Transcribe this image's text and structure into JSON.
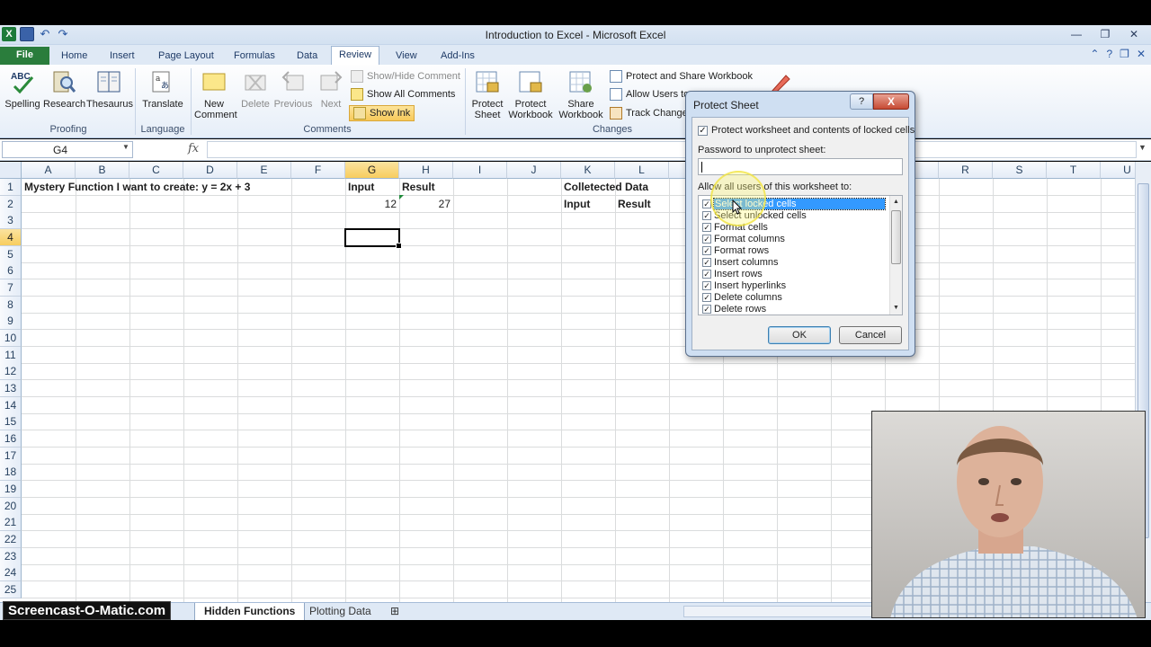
{
  "window": {
    "title": "Introduction to Excel  -  Microsoft Excel"
  },
  "ribbon_tabs": [
    "File",
    "Home",
    "Insert",
    "Page Layout",
    "Formulas",
    "Data",
    "Review",
    "View",
    "Add-Ins"
  ],
  "active_tab": "Review",
  "ribbon": {
    "proofing": {
      "label": "Proofing",
      "spelling": "Spelling",
      "research": "Research",
      "thesaurus": "Thesaurus",
      "abc_icon_text": "ABC"
    },
    "language": {
      "label": "Language",
      "translate": "Translate"
    },
    "comments": {
      "label": "Comments",
      "new_comment_1": "New",
      "new_comment_2": "Comment",
      "delete": "Delete",
      "previous": "Previous",
      "next": "Next",
      "show_hide": "Show/Hide Comment",
      "show_all": "Show All Comments",
      "show_ink": "Show Ink"
    },
    "changes": {
      "label": "Changes",
      "protect_sheet_1": "Protect",
      "protect_sheet_2": "Sheet",
      "protect_workbook_1": "Protect",
      "protect_workbook_2": "Workbook",
      "share_workbook_1": "Share",
      "share_workbook_2": "Workbook",
      "protect_and_share": "Protect and Share Workbook",
      "allow_users": "Allow Users to",
      "track_changes": "Track Change"
    }
  },
  "formula_bar": {
    "name_box": "G4",
    "fx": "fx",
    "formula": ""
  },
  "columns": [
    "A",
    "B",
    "C",
    "D",
    "E",
    "F",
    "G",
    "H",
    "I",
    "J",
    "K",
    "L",
    "R",
    "S",
    "T",
    "U"
  ],
  "rows": [
    "1",
    "2",
    "3",
    "4",
    "5",
    "6",
    "7",
    "8",
    "9",
    "10",
    "11",
    "12",
    "13",
    "14",
    "15",
    "16",
    "17",
    "18",
    "19",
    "20",
    "21",
    "22",
    "23",
    "24",
    "25"
  ],
  "cells": {
    "A1": "Mystery Function I want to create: y = 2x + 3",
    "G1": "Input",
    "H1": "Result",
    "G2": "12",
    "H2": "27",
    "K1": "Colletected Data",
    "K2": "Input",
    "L2": "Result"
  },
  "sheet_tabs": [
    "Hidden Functions",
    "Plotting Data"
  ],
  "active_sheet": "Hidden Functions",
  "watermark": "Screencast-O-Matic.com",
  "dialog": {
    "title": "Protect Sheet",
    "help": "?",
    "close": "X",
    "protect_label": "Protect worksheet and contents of locked cells",
    "protect_checked": true,
    "password_label": "Password to unprotect sheet:",
    "password_value": "",
    "allow_label": "Allow all users of this worksheet to:",
    "options": [
      {
        "label": "Select locked cells",
        "checked": true,
        "selected": true
      },
      {
        "label": "Select unlocked cells",
        "checked": true
      },
      {
        "label": "Format cells",
        "checked": true
      },
      {
        "label": "Format columns",
        "checked": true
      },
      {
        "label": "Format rows",
        "checked": true
      },
      {
        "label": "Insert columns",
        "checked": true
      },
      {
        "label": "Insert rows",
        "checked": true
      },
      {
        "label": "Insert hyperlinks",
        "checked": true
      },
      {
        "label": "Delete columns",
        "checked": true
      },
      {
        "label": "Delete rows",
        "checked": true
      }
    ],
    "ok": "OK",
    "cancel": "Cancel"
  },
  "colors": {
    "file_tab": "#2a7d3c",
    "selection_header": "#f7cd5e",
    "list_selection": "#3399ff"
  }
}
